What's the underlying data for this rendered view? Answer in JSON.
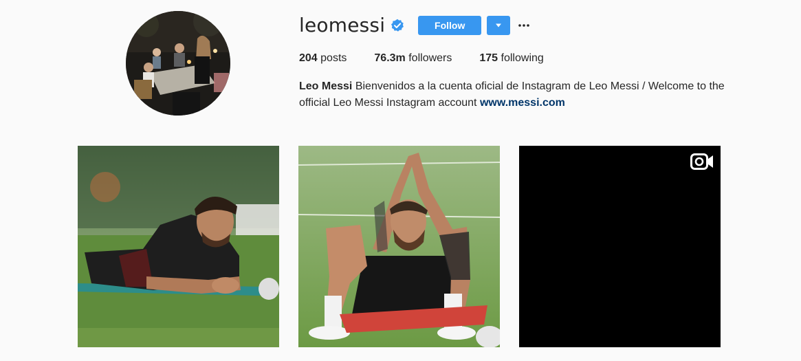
{
  "profile": {
    "username": "leomessi",
    "verified_icon": "verified-badge-icon",
    "follow_label": "Follow",
    "dropdown_icon": "caret-down-icon",
    "more_icon": "ellipsis-icon",
    "accent_color": "#3897f0"
  },
  "stats": {
    "posts_count": "204",
    "posts_label": "posts",
    "followers_count": "76.3m",
    "followers_label": "followers",
    "following_count": "175",
    "following_label": "following"
  },
  "bio": {
    "name": "Leo Messi",
    "text": "Bienvenidos a la cuenta oficial de Instagram de Leo Messi / Welcome to the official Leo Messi Instagram account",
    "link": "www.messi.com",
    "link_color": "#003569"
  },
  "posts": [
    {
      "type": "photo"
    },
    {
      "type": "photo"
    },
    {
      "type": "video",
      "icon": "video-camera-icon"
    }
  ]
}
